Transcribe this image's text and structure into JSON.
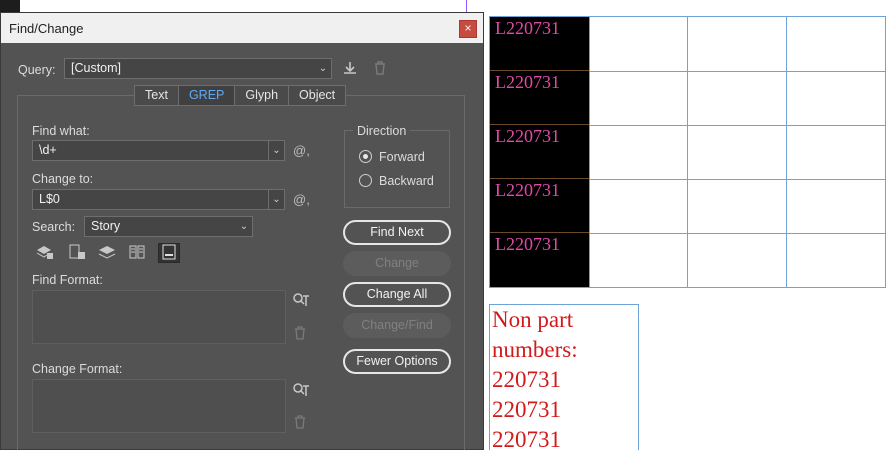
{
  "dialog": {
    "title": "Find/Change",
    "close_glyph": "×",
    "query_label": "Query:",
    "query_value": "[Custom]",
    "tabs": [
      {
        "label": "Text",
        "active": false
      },
      {
        "label": "GREP",
        "active": true
      },
      {
        "label": "Glyph",
        "active": false
      },
      {
        "label": "Object",
        "active": false
      }
    ],
    "find_what_label": "Find what:",
    "find_what_value": "\\d+",
    "change_to_label": "Change to:",
    "change_to_value": "L$0",
    "search_label": "Search:",
    "search_value": "Story",
    "find_format_label": "Find Format:",
    "change_format_label": "Change Format:",
    "direction": {
      "title": "Direction",
      "options": [
        {
          "label": "Forward",
          "selected": true
        },
        {
          "label": "Backward",
          "selected": false
        }
      ]
    },
    "buttons": {
      "find_next": "Find Next",
      "change": "Change",
      "change_all": "Change All",
      "change_find": "Change/Find",
      "fewer_options": "Fewer Options"
    },
    "special_char_glyph": "@,"
  },
  "document": {
    "table_cells": [
      "L220731",
      "L220731",
      "L220731",
      "L220731",
      "L220731"
    ],
    "text_frame_lines": [
      "Non part",
      "numbers:",
      "220731",
      "220731",
      "220731"
    ]
  },
  "colors": {
    "dialog_bg": "#535353",
    "active_tab_text": "#5ea9f6",
    "cell_text": "#e04aa8",
    "frame_text": "#d21a1a",
    "frame_border": "#6fa3d8"
  }
}
